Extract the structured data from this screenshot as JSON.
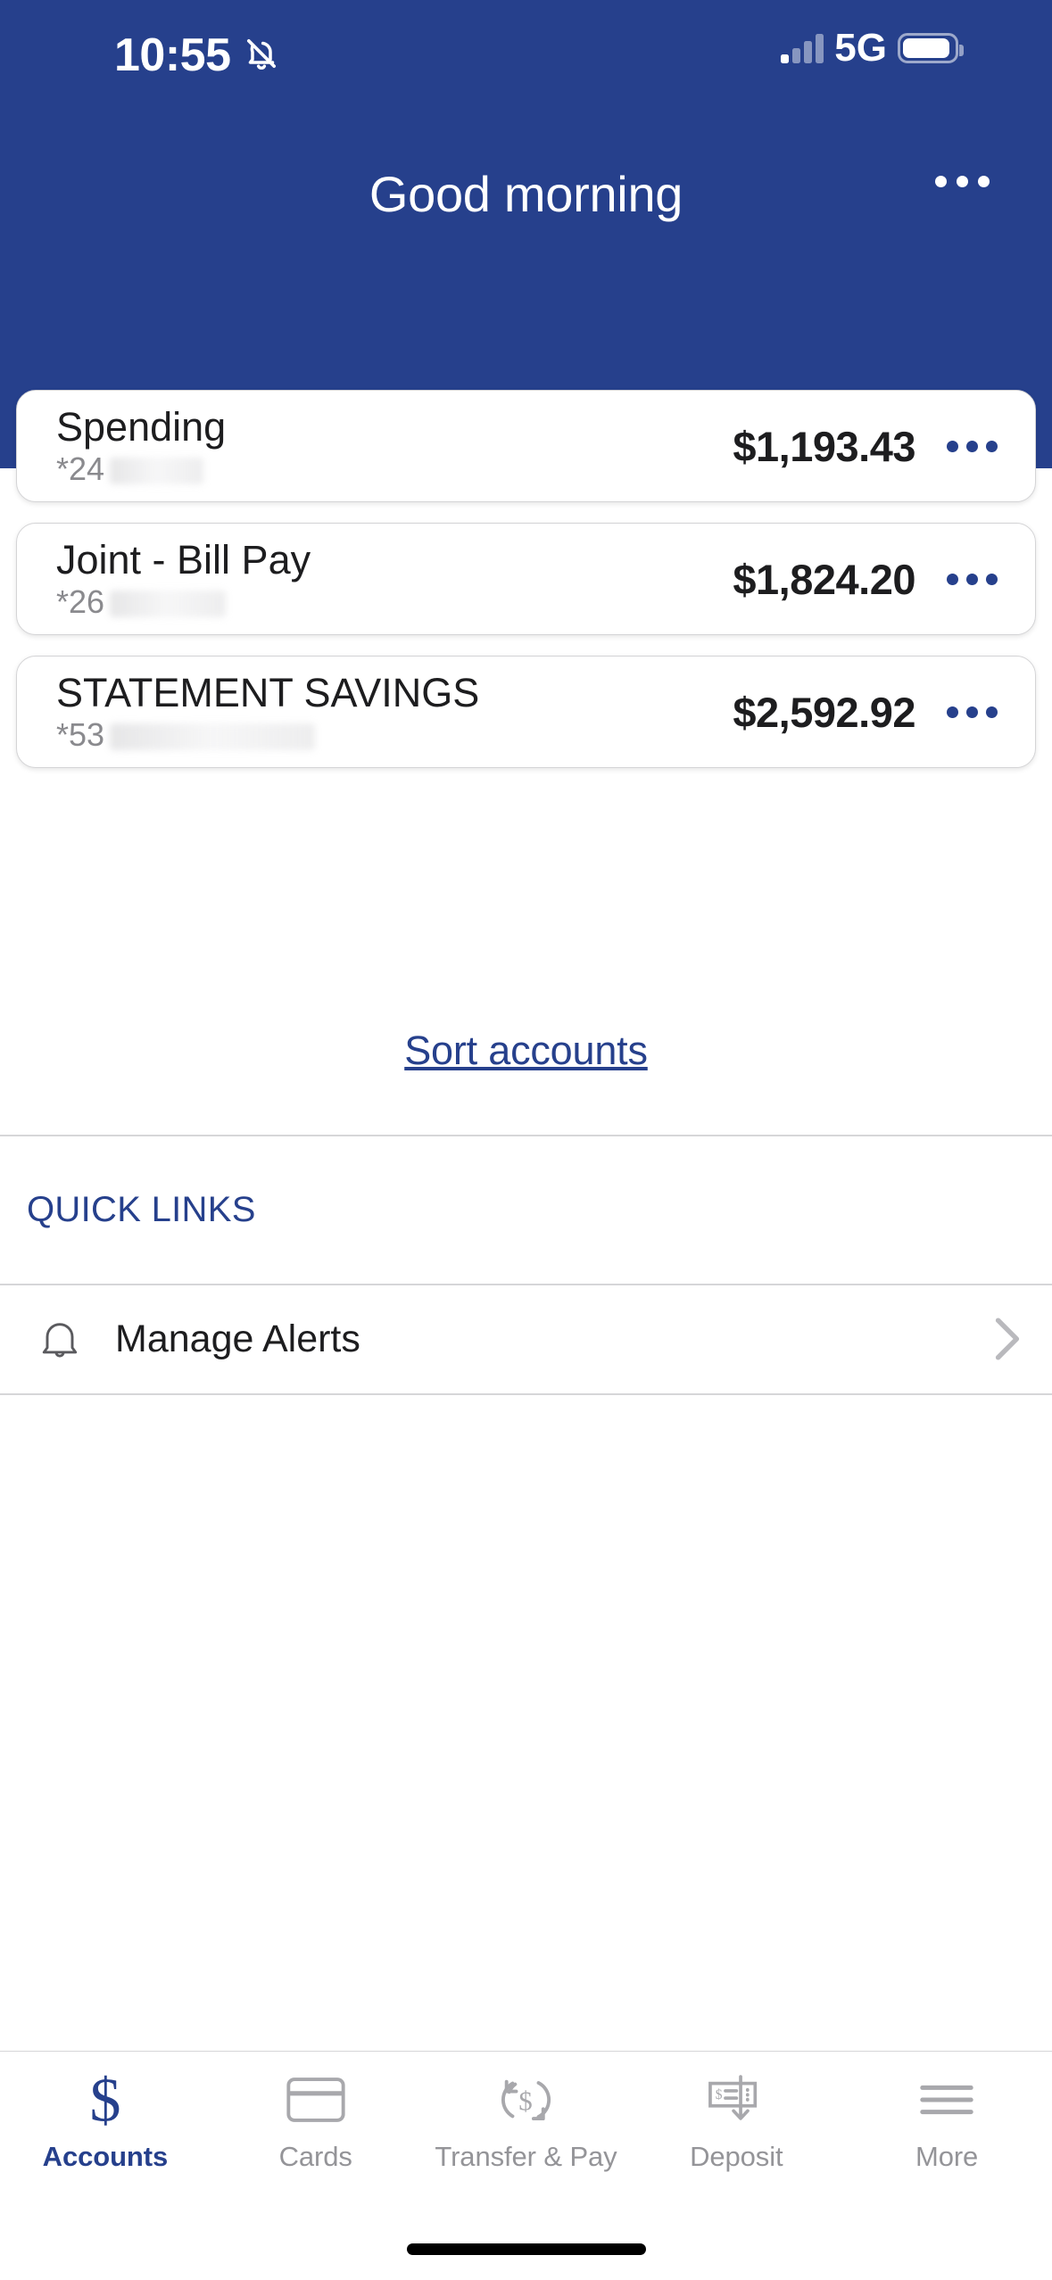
{
  "status_bar": {
    "time": "10:55",
    "silent_icon": "bell-slash-icon",
    "signal_icon": "cellular-bars-icon",
    "network": "5G",
    "battery_icon": "battery-icon"
  },
  "header": {
    "background_color": "#26408c",
    "greeting": "Good morning",
    "overflow_menu_label": "•••",
    "overflow_icon": "ellipsis-icon"
  },
  "accounts": [
    {
      "name": "Spending",
      "mask": "*24",
      "balance": "$1,193.43",
      "redacted_width": 105,
      "more_icon": "ellipsis-icon"
    },
    {
      "name": "Joint - Bill Pay",
      "mask": "*26",
      "balance": "$1,824.20",
      "redacted_width": 130,
      "more_icon": "ellipsis-icon"
    },
    {
      "name": "STATEMENT SAVINGS",
      "mask": "*53",
      "balance": "$2,592.92",
      "redacted_width": 230,
      "more_icon": "ellipsis-icon"
    }
  ],
  "sort": {
    "label": "Sort accounts"
  },
  "quick_links": {
    "header": "QUICK LINKS",
    "items": [
      {
        "label": "Manage Alerts",
        "icon": "bell-icon",
        "chevron": "chevron-right-icon"
      }
    ]
  },
  "tab_bar": {
    "active_color": "#26408c",
    "inactive_color": "#949498",
    "tabs": [
      {
        "label": "Accounts",
        "icon": "dollar-sign-icon",
        "active": true
      },
      {
        "label": "Cards",
        "icon": "credit-card-icon",
        "active": false
      },
      {
        "label": "Transfer & Pay",
        "icon": "transfer-arrows-dollar-icon",
        "active": false
      },
      {
        "label": "Deposit",
        "icon": "check-deposit-down-arrow-icon",
        "active": false
      },
      {
        "label": "More",
        "icon": "hamburger-menu-icon",
        "active": false
      }
    ]
  }
}
